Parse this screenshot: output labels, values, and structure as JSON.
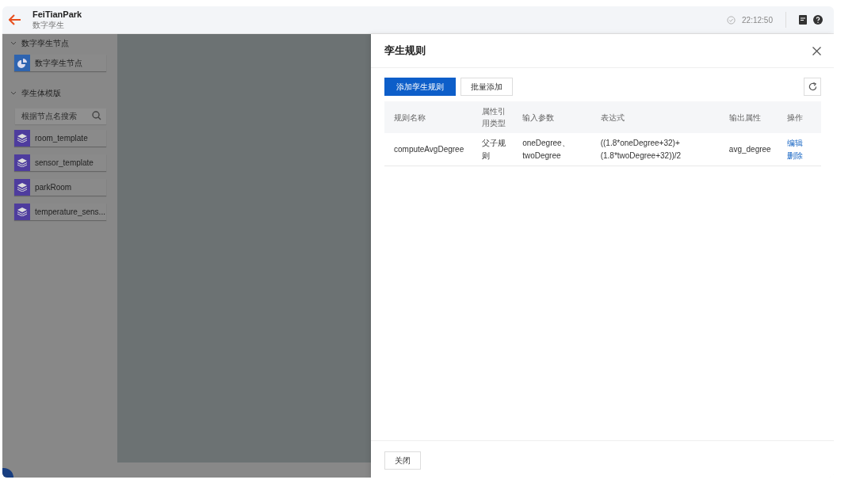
{
  "header": {
    "title": "FeiTianPark",
    "subtitle": "数字孪生",
    "time": "22:12:50"
  },
  "sidebar": {
    "sections": [
      {
        "title": "数字孪生节点",
        "expanded": true,
        "kind": "node",
        "items": [
          {
            "label": "数字孪生节点"
          }
        ]
      },
      {
        "title": "孪生体模版",
        "expanded": true,
        "kind": "template",
        "search": {
          "placeholder": "根据节点名搜索"
        },
        "items": [
          {
            "label": "room_template"
          },
          {
            "label": "sensor_template"
          },
          {
            "label": "parkRoom"
          },
          {
            "label": "temperature_sens..."
          }
        ]
      }
    ]
  },
  "drawer": {
    "title": "孪生规则",
    "buttons": [
      {
        "label": "添加孪生规则",
        "kind": "primary"
      },
      {
        "label": "批量添加",
        "kind": "default"
      }
    ],
    "table": {
      "columns": [
        "规则名称",
        "属性引用类型",
        "输入参数",
        "表达式",
        "输出属性",
        "操作"
      ],
      "rows": [
        {
          "name": "computeAvgDegree",
          "type": "父子规则",
          "inputs": "oneDegree、twoDegree",
          "expression": "((1.8*oneDegree+32)+(1.8*twoDegree+32))/2",
          "output": "avg_degree",
          "actions": [
            "编辑",
            "删除"
          ]
        }
      ]
    },
    "footer_button": "关闭"
  }
}
